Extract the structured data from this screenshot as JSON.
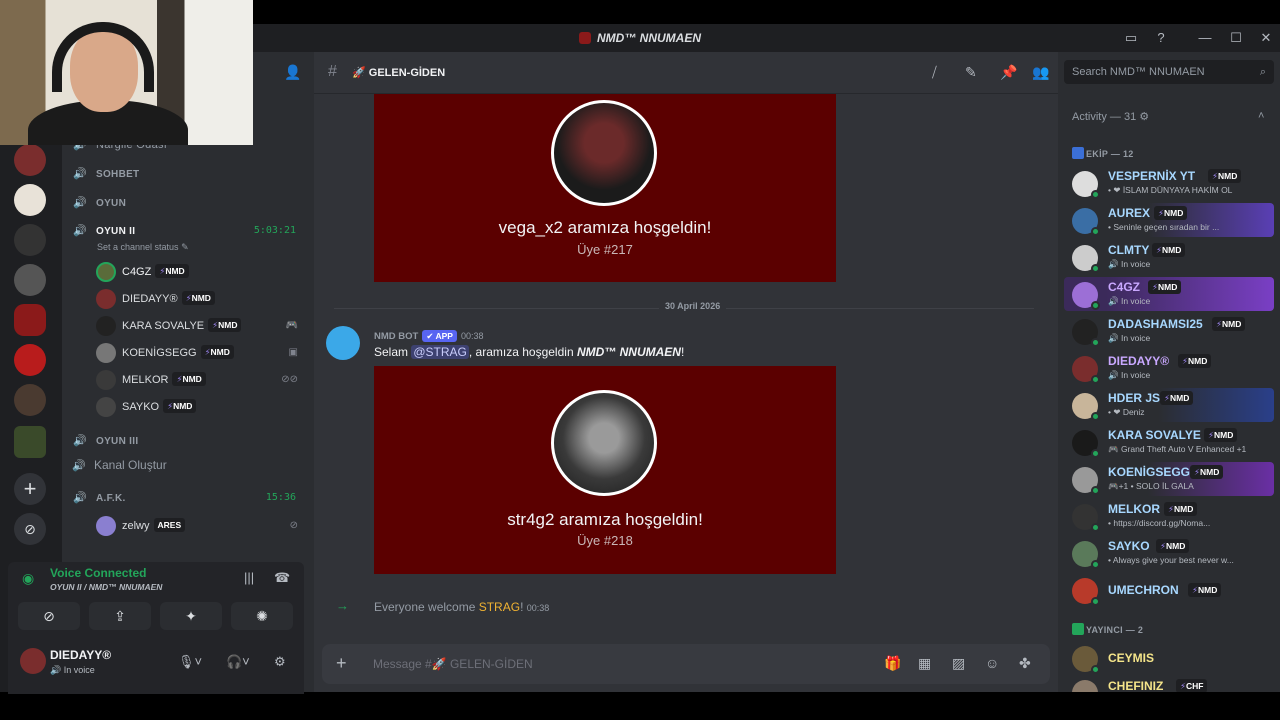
{
  "window": {
    "title": "NMD™ NNUMAEN",
    "controls": [
      "▭",
      "?",
      "—",
      "☐",
      "✕"
    ]
  },
  "channels": {
    "partial_top": "Nargile Odası",
    "sohbet": "SOHBET",
    "oyun": "OYUN",
    "oyun2": "OYUN II",
    "oyun2_timer": "5:03:21",
    "oyun2_status": "Set a channel status",
    "oyun3": "OYUN III",
    "kanal": "Kanal Oluştur",
    "afk": "A.F.K.",
    "afk_timer": "15:36",
    "voice_users": [
      {
        "name": "C4GZ",
        "tag": "NMD",
        "color": "#5a6b3a"
      },
      {
        "name": "DIEDAYY®",
        "tag": "NMD",
        "color": "#7a2d2d"
      },
      {
        "name": "KARA SOVALYE",
        "tag": "NMD",
        "color": "#222"
      },
      {
        "name": "KOENİGSEGG",
        "tag": "NMD",
        "color": "#777"
      },
      {
        "name": "MELKOR",
        "tag": "NMD",
        "color": "#3a3a3a"
      },
      {
        "name": "SAYKO",
        "tag": "NMD",
        "color": "#444"
      }
    ],
    "afk_user": {
      "name": "zelwy",
      "tag": "ARES"
    }
  },
  "voice_panel": {
    "title": "Voice Connected",
    "subtitle": "OYUN II / NMD™ NNUMAEN",
    "user_name": "DIEDAYY®",
    "user_status": "In voice"
  },
  "chat": {
    "channel": "GELEN-GİDEN",
    "embed1": {
      "welcome": "vega_x2 aramıza hoşgeldin!",
      "member": "Üye #217"
    },
    "date_divider": "30 April 2026",
    "bot_name": "NMD BOT",
    "bot_tag": "✔ APP",
    "bot_time": "00:38",
    "msg_prefix": "Selam ",
    "msg_mention": "@STRAG",
    "msg_mid": ", aramıza hoşgeldin ",
    "msg_server": "NMD™ NNUMAEN",
    "msg_end": "!",
    "embed2": {
      "welcome": "str4g2 aramıza hoşgeldin!",
      "member": "Üye #218"
    },
    "sys_prefix": "Everyone welcome ",
    "sys_user": "STRAG",
    "sys_end": "!",
    "sys_time": "00:38",
    "composer_placeholder": "Message #🚀 GELEN-GİDEN"
  },
  "members": {
    "search_placeholder": "Search NMD™ NNUMAEN",
    "activity_header": "Activity — 31",
    "group1": "EKİP — 12",
    "group2": "YAYINCI — 2",
    "list": [
      {
        "name": "VESPERNİX YT",
        "tag": "NMD",
        "status": "• ❤ İSLAM DÜNYAYA HAKİM OL",
        "color": "#a8d8ff"
      },
      {
        "name": "AUREX",
        "tag": "NMD",
        "status": "• Seninle geçen sıradan bir ...",
        "color": "#a8d8ff"
      },
      {
        "name": "CLMTY",
        "tag": "NMD",
        "status": "In voice",
        "color": "#a8d8ff"
      },
      {
        "name": "C4GZ",
        "tag": "NMD",
        "status": "In voice",
        "color": "#c9a8ff"
      },
      {
        "name": "DADASHAMSI25",
        "tag": "NMD",
        "status": "In voice",
        "color": "#a8d8ff"
      },
      {
        "name": "DIEDAYY®",
        "tag": "NMD",
        "status": "In voice",
        "color": "#c9a8ff"
      },
      {
        "name": "HDER JS",
        "tag": "NMD",
        "status": "• ❤ Deniz",
        "color": "#a8d8ff"
      },
      {
        "name": "KARA SOVALYE",
        "tag": "NMD",
        "status": "🎮 Grand Theft Auto V Enhanced +1",
        "color": "#a8d8ff"
      },
      {
        "name": "KOENİGSEGG",
        "tag": "NMD",
        "status": "🎮+1 • SOLO İL GALA",
        "color": "#a8d8ff"
      },
      {
        "name": "MELKOR",
        "tag": "NMD",
        "status": "• https://discord.gg/Noma...",
        "color": "#a8d8ff"
      },
      {
        "name": "SAYKO",
        "tag": "NMD",
        "status": "• Always give your best never w...",
        "color": "#a8d8ff"
      },
      {
        "name": "UMECHRON",
        "tag": "NMD",
        "status": "",
        "color": "#a8d8ff"
      },
      {
        "name": "CEYMIS",
        "tag": "",
        "status": "",
        "color": "#f5e58a"
      },
      {
        "name": "CHEFINIZ",
        "tag": "CHF",
        "status": "",
        "color": "#f5e58a"
      }
    ]
  }
}
